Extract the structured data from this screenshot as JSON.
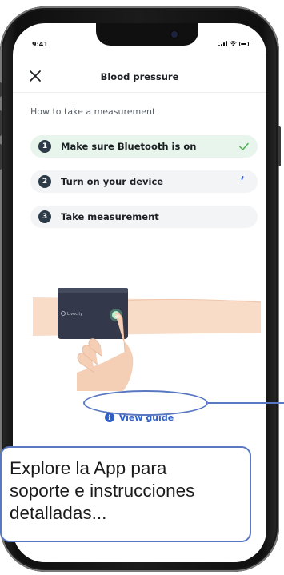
{
  "status_bar": {
    "time": "9:41"
  },
  "nav": {
    "title": "Blood pressure",
    "close_icon": "close-icon"
  },
  "section_label": "How to take a measurement",
  "steps": [
    {
      "number": "1",
      "label": "Make sure Bluetooth is on",
      "state": "done"
    },
    {
      "number": "2",
      "label": "Turn on your device",
      "state": "pending"
    },
    {
      "number": "3",
      "label": "Take measurement",
      "state": "pending"
    }
  ],
  "device": {
    "brand": "Livecity"
  },
  "guide": {
    "label": "View guide",
    "icon": "info-icon"
  },
  "callout": {
    "text": "Explore la App para\nsoporte e instrucciones\ndetalladas..."
  },
  "colors": {
    "accent_blue": "#2f5fc4",
    "success_green": "#4caf50",
    "active_step_bg": "#e8f5ec",
    "step_bg": "#f3f4f5",
    "annotation": "#5a78c2"
  }
}
